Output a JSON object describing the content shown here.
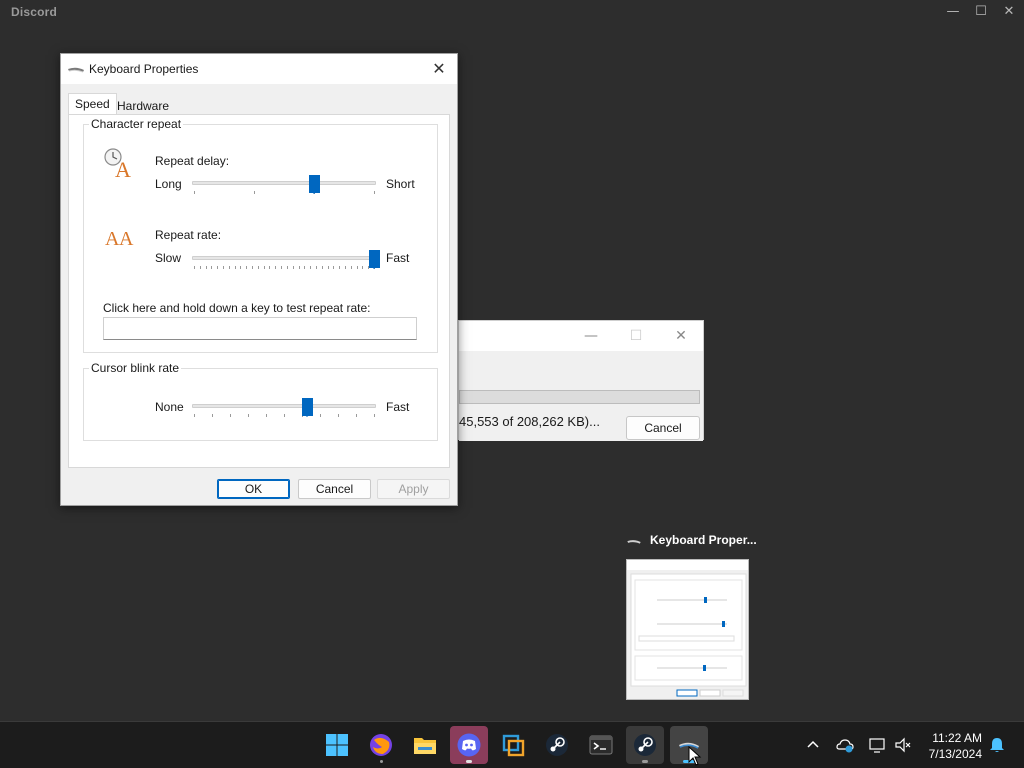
{
  "discord": {
    "title": "Discord",
    "minimize_glyph": "—",
    "maximize_glyph": "☐",
    "close_glyph": "✕"
  },
  "download_dialog": {
    "status_text": "45,553 of 208,262 KB)...",
    "cancel_label": "Cancel",
    "minimize_glyph": "—",
    "maximize_glyph": "☐",
    "close_glyph": "✕"
  },
  "keyboard_properties": {
    "title": "Keyboard Properties",
    "close_glyph": "✕",
    "tabs": [
      {
        "label": "Speed",
        "selected": true
      },
      {
        "label": "Hardware",
        "selected": false
      }
    ],
    "character_repeat": {
      "group_label": "Character repeat",
      "repeat_delay": {
        "label": "Repeat delay:",
        "min_label": "Long",
        "max_label": "Short",
        "value_fraction": 0.67,
        "tick_count": 4
      },
      "repeat_rate": {
        "label": "Repeat rate:",
        "min_label": "Slow",
        "max_label": "Fast",
        "value_fraction": 1.0,
        "tick_count": 32
      },
      "test_prompt": "Click here and hold down a key to test repeat rate:",
      "test_value": ""
    },
    "cursor_blink": {
      "group_label": "Cursor blink rate",
      "min_label": "None",
      "max_label": "Fast",
      "value_fraction": 0.63,
      "tick_count": 11
    },
    "buttons": {
      "ok": "OK",
      "cancel": "Cancel",
      "apply": "Apply"
    }
  },
  "taskbar_preview": {
    "title": "Keyboard Proper..."
  },
  "taskbar": {
    "apps": [
      "start",
      "firefox",
      "file-explorer",
      "discord",
      "virtualbox",
      "steam",
      "terminal",
      "steam",
      "keyboard-properties"
    ],
    "clock_time": "11:22 AM",
    "clock_date": "7/13/2024"
  },
  "colors": {
    "accent": "#0067c0",
    "desktop_bg": "#2d2d2d",
    "taskbar_bg": "#1c1c1c"
  }
}
